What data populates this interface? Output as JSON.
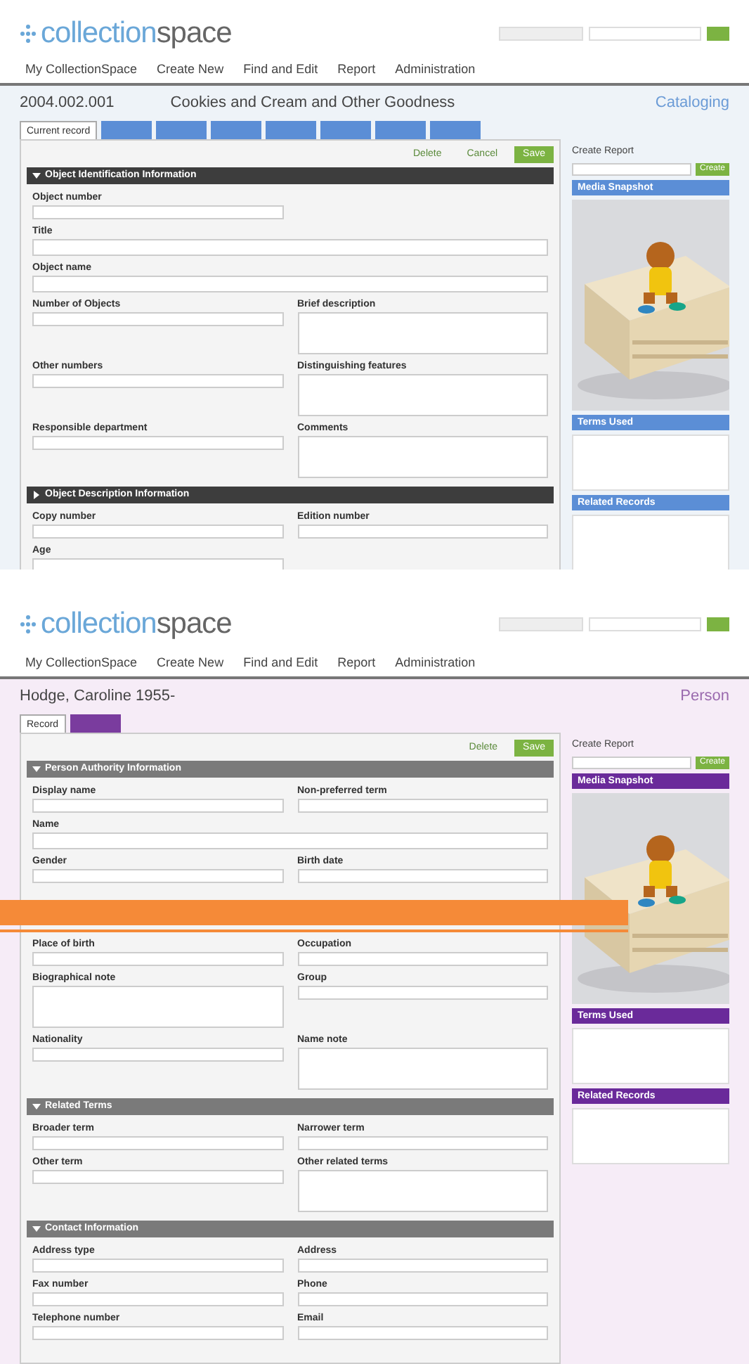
{
  "screens": [
    {
      "kind": "cataloging",
      "logo": {
        "prefix": "collection",
        "suffix": "space"
      },
      "nav": [
        "My CollectionSpace",
        "Create New",
        "Find and Edit",
        "Report",
        "Administration"
      ],
      "record_id": "2004.002.001",
      "record_title": "Cookies and Cream and Other Goodness",
      "record_type": "Cataloging",
      "tabs": [
        {
          "label": "Current record",
          "selected": true
        },
        {
          "selected": false
        },
        {
          "selected": false
        },
        {
          "selected": false
        },
        {
          "selected": false
        },
        {
          "selected": false
        },
        {
          "selected": false
        },
        {
          "selected": false
        }
      ],
      "actions": [
        "Delete",
        "Cancel",
        "Save"
      ],
      "sections": [
        {
          "title": "Object Identification Information",
          "expanded": true,
          "fields": [
            {
              "label": "Object number",
              "kind": "input"
            },
            {
              "label": "Title",
              "kind": "wide"
            },
            {
              "label": "Object name",
              "kind": "wide"
            },
            {
              "label": "Number of Objects",
              "kind": "input"
            },
            {
              "label": "Brief description",
              "kind": "area"
            },
            {
              "label": "Other numbers",
              "kind": "input"
            },
            {
              "label": "Distinguishing features",
              "kind": "area"
            },
            {
              "label": "Responsible department",
              "kind": "input"
            },
            {
              "label": "Comments",
              "kind": "area"
            }
          ]
        },
        {
          "title": "Object Description Information",
          "expanded": false,
          "fields": [
            {
              "label": "Copy number",
              "kind": "input"
            },
            {
              "label": "Edition number",
              "kind": "input"
            },
            {
              "label": "Age",
              "kind": "input"
            }
          ]
        }
      ],
      "sidebar": {
        "create_report": "Create Report",
        "generate": "Create",
        "panels": [
          "Media Snapshot",
          "Terms Used",
          "Related Records"
        ]
      }
    },
    {
      "kind": "person",
      "logo": {
        "prefix": "collection",
        "suffix": "space"
      },
      "nav": [
        "My CollectionSpace",
        "Create New",
        "Find and Edit",
        "Report",
        "Administration"
      ],
      "record_title": "Hodge, Caroline 1955-",
      "record_type": "Person",
      "tabs": [
        {
          "label": "Record",
          "selected": true
        },
        {
          "selected": false
        }
      ],
      "actions": [
        "Delete",
        "Save"
      ],
      "sections": [
        {
          "title": "Person Authority Information",
          "expanded": true,
          "fields": [
            {
              "label": "Display name",
              "kind": "input"
            },
            {
              "label": "Non-preferred term",
              "kind": "input"
            },
            {
              "label": "Name",
              "kind": "wide"
            },
            {
              "label": "Gender",
              "kind": "input"
            },
            {
              "label": "Birth date",
              "kind": "input"
            },
            {
              "label": "Place of birth",
              "kind": "input"
            },
            {
              "label": "Occupation",
              "kind": "input"
            },
            {
              "label": "Biographical note",
              "kind": "area"
            },
            {
              "label": "Group",
              "kind": "input"
            },
            {
              "label": "Nationality",
              "kind": "input"
            },
            {
              "label": "Name note",
              "kind": "area"
            }
          ]
        },
        {
          "title": "Related Terms",
          "expanded": true,
          "fields": [
            {
              "label": "Broader term",
              "kind": "input"
            },
            {
              "label": "Narrower term",
              "kind": "input"
            },
            {
              "label": "Other term",
              "kind": "input"
            },
            {
              "label": "Other related terms",
              "kind": "area"
            }
          ]
        },
        {
          "title": "Contact Information",
          "expanded": true,
          "fields": [
            {
              "label": "Address type",
              "kind": "input"
            },
            {
              "label": "Address",
              "kind": "input"
            },
            {
              "label": "Fax number",
              "kind": "input"
            },
            {
              "label": "Phone",
              "kind": "input"
            },
            {
              "label": "Telephone number",
              "kind": "input"
            },
            {
              "label": "Email",
              "kind": "input"
            }
          ]
        }
      ],
      "sidebar": {
        "create_report": "Create Report",
        "generate": "Create",
        "panels": [
          "Media Snapshot",
          "Terms Used",
          "Related Records"
        ]
      }
    }
  ]
}
